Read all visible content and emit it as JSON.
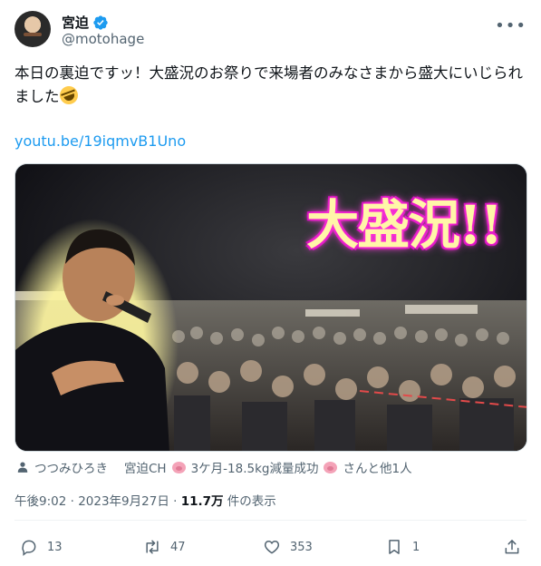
{
  "user": {
    "display_name": "宮迫",
    "handle": "@motohage",
    "verified": true,
    "avatar_icon": "user-avatar"
  },
  "more_icon": "more-horizontal-icon",
  "tweet": {
    "text": "本日の裏迫ですッ！大盛況のお祭りで来場者のみなさまから盛大にいじられました",
    "emoji": "rolling-on-floor-laughing-emoji",
    "link": "youtu.be/19iqmvB1Uno"
  },
  "media": {
    "banner_text": "大盛況!!",
    "description_icon": "crowd-photo"
  },
  "tags": {
    "person_icon": "person-icon",
    "tag1": "つつみひろき",
    "tag2_prefix": "宮迫CH",
    "tag2_mid": "3ケ月-18.5kg減量成功",
    "tag2_suffix": "さんと他1人"
  },
  "meta": {
    "time_date": "午後9:02 · 2023年9月27日 · ",
    "views_count": "11.7万",
    "views_label": " 件の表示"
  },
  "actions": {
    "reply_count": "13",
    "retweet_count": "47",
    "like_count": "353",
    "bookmark_count": "1"
  },
  "colors": {
    "accent": "#1d9bf0",
    "secondary_text": "#536471",
    "banner_glow": "#ff2bd6",
    "banner_fill": "#fff6a8"
  }
}
